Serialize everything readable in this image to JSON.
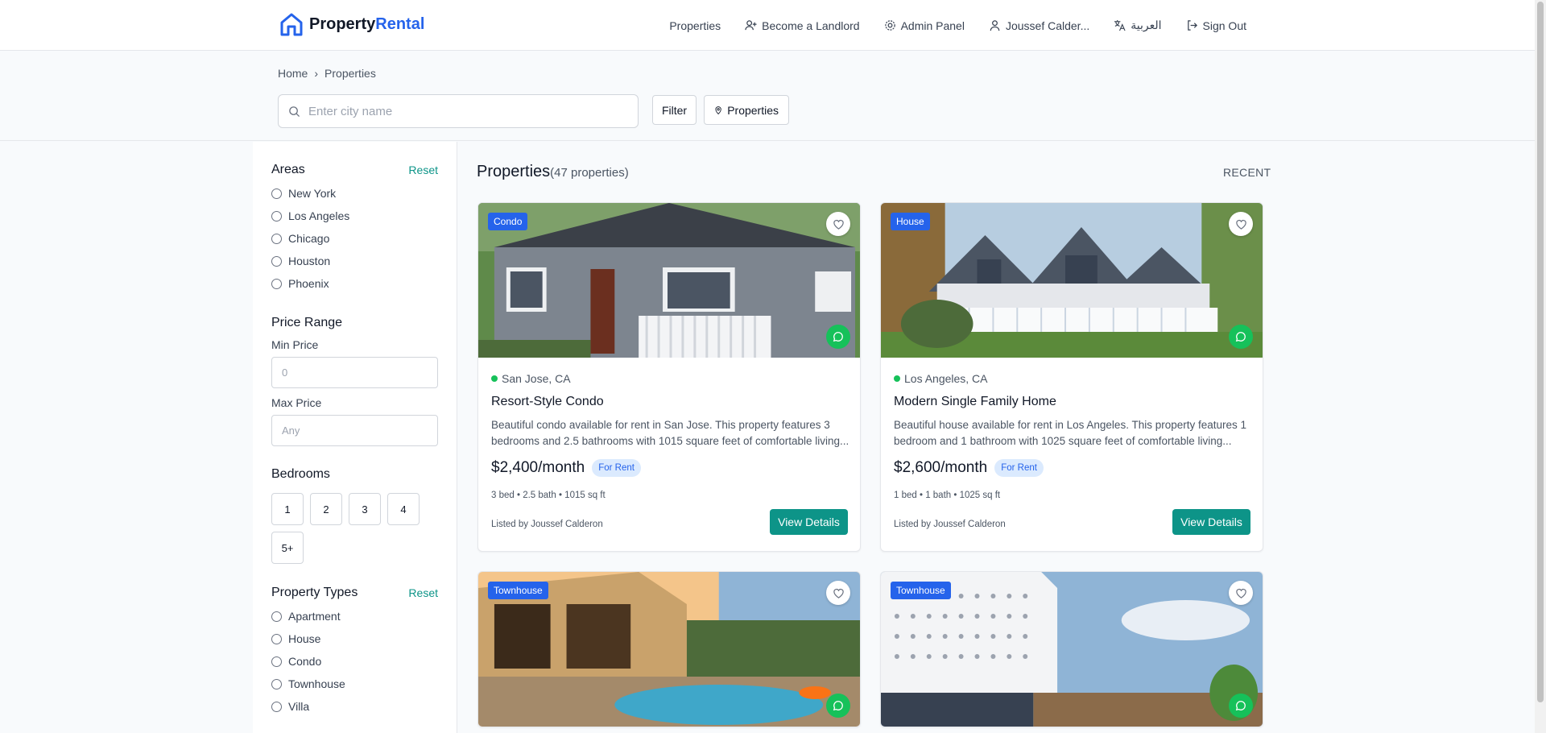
{
  "header": {
    "brand_main": "Property",
    "brand_accent": "Rental",
    "nav": {
      "properties": "Properties",
      "become_landlord": "Become a Landlord",
      "admin_panel": "Admin Panel",
      "user": "Joussef Calder...",
      "language": "العربية",
      "sign_out": "Sign Out"
    }
  },
  "breadcrumb": {
    "home": "Home",
    "separator": "›",
    "current": "Properties"
  },
  "search": {
    "placeholder": "Enter city name",
    "value": ""
  },
  "toolbar": {
    "filter_label": "Filter",
    "properties_label": "Properties"
  },
  "sidebar": {
    "areas": {
      "title": "Areas",
      "reset": "Reset",
      "options": [
        "New York",
        "Los Angeles",
        "Chicago",
        "Houston",
        "Phoenix"
      ]
    },
    "price": {
      "title": "Price Range",
      "min_label": "Min Price",
      "min_placeholder": "0",
      "max_label": "Max Price",
      "max_placeholder": "Any"
    },
    "bedrooms": {
      "title": "Bedrooms",
      "options": [
        "1",
        "2",
        "3",
        "4",
        "5+"
      ]
    },
    "types": {
      "title": "Property Types",
      "reset": "Reset",
      "options": [
        "Apartment",
        "House",
        "Condo",
        "Townhouse",
        "Villa"
      ]
    }
  },
  "main": {
    "title": "Properties",
    "count": "(47 properties)",
    "sort": "RECENT"
  },
  "cards": [
    {
      "type": "Condo",
      "location": "San Jose, CA",
      "title": "Resort-Style Condo",
      "description": "Beautiful condo available for rent in San Jose. This property features 3 bedrooms and 2.5 bathrooms with 1015 square feet of comfortable living...",
      "price": "$2,400/month",
      "status": "For Rent",
      "specs": "3 bed • 2.5 bath • 1015 sq ft",
      "listed_by": "Listed by Joussef Calderon",
      "action": "View Details"
    },
    {
      "type": "House",
      "location": "Los Angeles, CA",
      "title": "Modern Single Family Home",
      "description": "Beautiful house available for rent in Los Angeles. This property features 1 bedroom and 1 bathroom with 1025 square feet of comfortable living...",
      "price": "$2,600/month",
      "status": "For Rent",
      "specs": "1 bed • 1 bath • 1025 sq ft",
      "listed_by": "Listed by Joussef Calderon",
      "action": "View Details"
    },
    {
      "type": "Townhouse"
    },
    {
      "type": "Townhouse"
    }
  ],
  "colors": {
    "brand": "#2563eb",
    "accent_teal": "#0d9488",
    "chat_green": "#16c15a",
    "badge_blue": "#2563eb"
  }
}
